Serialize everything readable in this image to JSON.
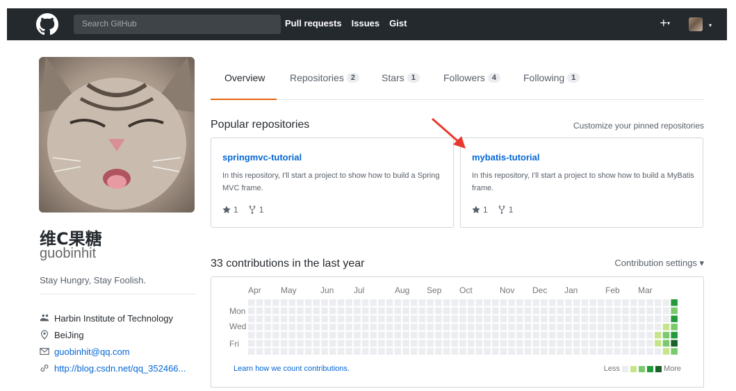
{
  "header": {
    "search_placeholder": "Search GitHub",
    "nav": [
      "Pull requests",
      "Issues",
      "Gist"
    ],
    "plus": "+"
  },
  "profile": {
    "fullname": "维C果糖",
    "username": "guobinhit",
    "bio": "Stay Hungry, Stay Foolish.",
    "organization": "Harbin Institute of Technology",
    "location": "BeiJing",
    "email": "guobinhit@qq.com",
    "blog": "http://blog.csdn.net/qq_352466..."
  },
  "tabs": [
    {
      "label": "Overview",
      "count": ""
    },
    {
      "label": "Repositories",
      "count": "2"
    },
    {
      "label": "Stars",
      "count": "1"
    },
    {
      "label": "Followers",
      "count": "4"
    },
    {
      "label": "Following",
      "count": "1"
    }
  ],
  "popular": {
    "title": "Popular repositories",
    "customize": "Customize your pinned repositories",
    "repos": [
      {
        "name": "springmvc-tutorial",
        "desc": "In this repository, I'll start a project to show how to build a Spring MVC frame.",
        "stars": "1",
        "forks": "1"
      },
      {
        "name": "mybatis-tutorial",
        "desc": "In this repository, I'll start a project to show how to build a MyBatis frame.",
        "stars": "1",
        "forks": "1"
      }
    ]
  },
  "contributions": {
    "title": "33 contributions in the last year",
    "settings": "Contribution settings ▾",
    "months": [
      "Apr",
      "May",
      "Jun",
      "Jul",
      "Aug",
      "Sep",
      "Oct",
      "Nov",
      "Dec",
      "Jan",
      "Feb",
      "Mar"
    ],
    "days": [
      "Mon",
      "Wed",
      "Fri"
    ],
    "learn": "Learn how we count contributions.",
    "less": "Less",
    "more": "More",
    "colors": [
      "#ebedf0",
      "#c6e48b",
      "#7bc96f",
      "#239a3b",
      "#196127"
    ]
  }
}
